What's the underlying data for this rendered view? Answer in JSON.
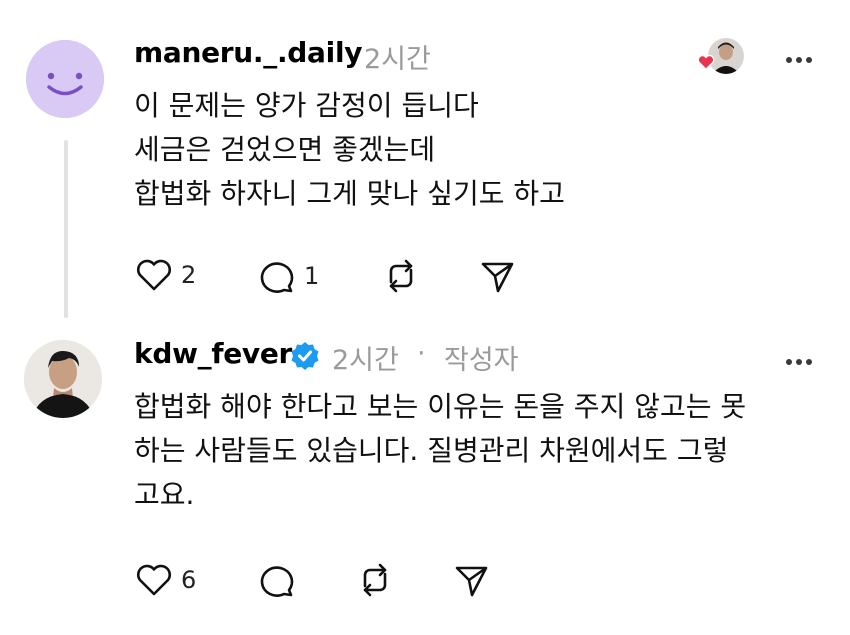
{
  "posts": [
    {
      "username": "maneru._.daily",
      "time": "2시간",
      "text": "이 문제는 양가 감정이 듭니다\n세금은 걷었으면 좋겠는데\n합법화 하자니 그게 맞나 싶기도 하고",
      "likes": "2",
      "replies": "1",
      "avatar_color": "#d8c9f5",
      "liked_by_author_badge_color": "#e8344e"
    },
    {
      "username": "kdw_fever",
      "time": "2시간",
      "separator": "·",
      "author_badge": "작성자",
      "text": "합법화 해야 한다고 보는 이유는 돈을 주지 않고는 못\n하는 사람들도 있습니다. 질병관리 차원에서도 그렇\n고요.",
      "likes": "6",
      "verified_color": "#1d9bf0"
    }
  ],
  "icons": [
    "heart-icon",
    "comment-icon",
    "repost-icon",
    "share-icon",
    "more-icon",
    "verified-icon"
  ]
}
